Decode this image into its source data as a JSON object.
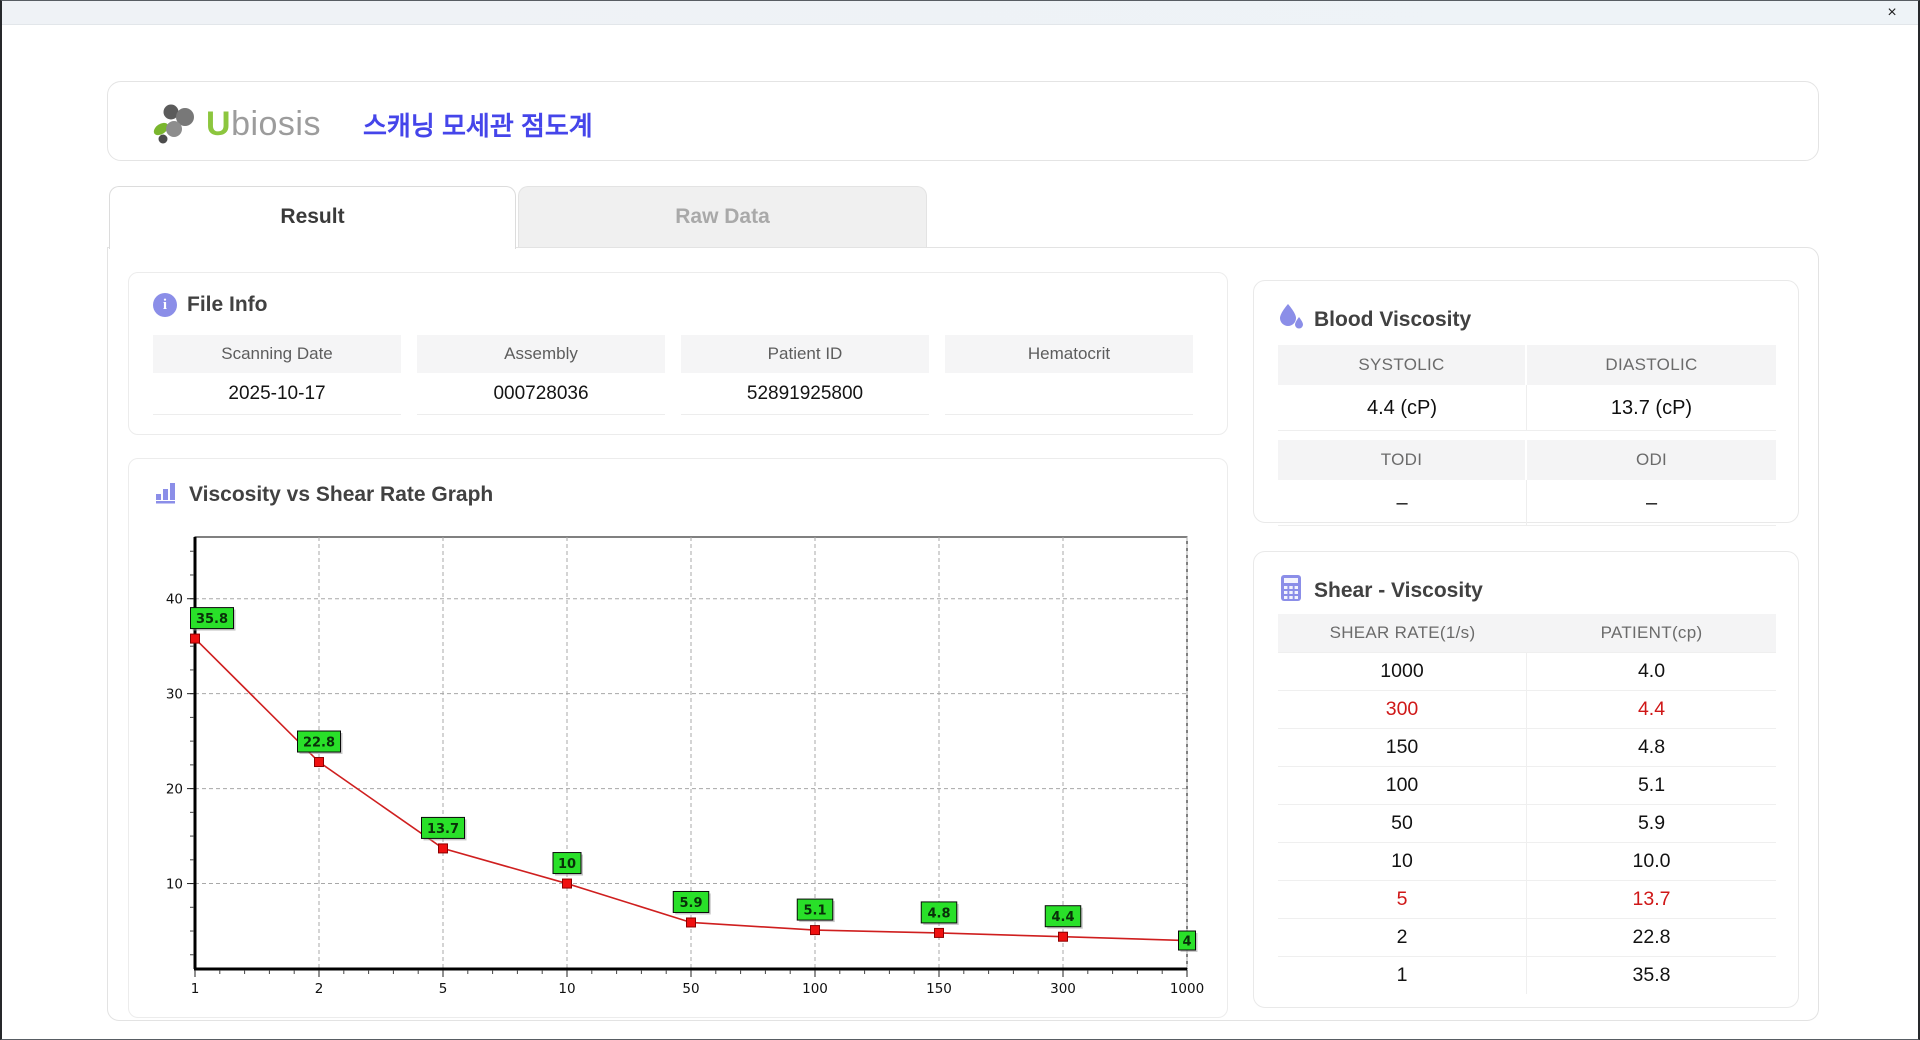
{
  "window": {
    "close_label": "×"
  },
  "header": {
    "brand_u": "U",
    "brand_rest": "biosis",
    "subtitle": "스캐닝 모세관 점도계",
    "brand_green": "#8cc63e",
    "subtitle_blue": "#4545ea"
  },
  "tabs": [
    {
      "label": "Result",
      "active": true
    },
    {
      "label": "Raw Data",
      "active": false
    }
  ],
  "file_info": {
    "title": "File Info",
    "fields": [
      {
        "label": "Scanning Date",
        "value": "2025-10-17"
      },
      {
        "label": "Assembly",
        "value": "000728036"
      },
      {
        "label": "Patient ID",
        "value": "52891925800"
      },
      {
        "label": "Hematocrit",
        "value": ""
      }
    ]
  },
  "blood_viscosity": {
    "title": "Blood Viscosity",
    "groups": [
      {
        "headers": [
          "SYSTOLIC",
          "DIASTOLIC"
        ],
        "values": [
          "4.4 (cP)",
          "13.7 (cP)"
        ]
      },
      {
        "headers": [
          "TODI",
          "ODI"
        ],
        "values": [
          "–",
          "–"
        ]
      }
    ]
  },
  "graph": {
    "title": "Viscosity vs Shear Rate Graph"
  },
  "chart_data": {
    "type": "line",
    "title": "Viscosity vs Shear Rate Graph",
    "x": [
      1,
      2,
      5,
      10,
      50,
      100,
      150,
      300,
      1000
    ],
    "x_tick_labels": [
      "1",
      "2",
      "5",
      "10",
      "50",
      "100",
      "150",
      "300",
      "1000"
    ],
    "x_axis_note": "categorical equal spacing of log-like shear-rate values",
    "values": [
      35.8,
      22.8,
      13.7,
      10.0,
      5.9,
      5.1,
      4.8,
      4.4,
      4.0
    ],
    "point_labels": [
      "35.8",
      "22.8",
      "13.7",
      "10",
      "5.9",
      "5.1",
      "4.8",
      "4.4",
      "4"
    ],
    "xlabel": "",
    "ylabel": "",
    "yticks": [
      10,
      20,
      30,
      40
    ],
    "ylim": [
      1,
      46.5
    ],
    "grid": true,
    "grid_style": "dashed",
    "line_color": "#cf1f1f",
    "marker": "square",
    "marker_color": "#f01010",
    "marker_stroke": "#8b0000",
    "point_label_bg": "#29e029",
    "legend": "none"
  },
  "shear_table": {
    "title": "Shear - Viscosity",
    "headers": [
      "SHEAR RATE(1/s)",
      "PATIENT(cp)"
    ],
    "rows": [
      {
        "rate": "1000",
        "patient": "4.0",
        "highlight": false
      },
      {
        "rate": "300",
        "patient": "4.4",
        "highlight": true
      },
      {
        "rate": "150",
        "patient": "4.8",
        "highlight": false
      },
      {
        "rate": "100",
        "patient": "5.1",
        "highlight": false
      },
      {
        "rate": "50",
        "patient": "5.9",
        "highlight": false
      },
      {
        "rate": "10",
        "patient": "10.0",
        "highlight": false
      },
      {
        "rate": "5",
        "patient": "13.7",
        "highlight": true
      },
      {
        "rate": "2",
        "patient": "22.8",
        "highlight": false
      },
      {
        "rate": "1",
        "patient": "35.8",
        "highlight": false
      }
    ],
    "highlight_color": "#cf1717"
  }
}
